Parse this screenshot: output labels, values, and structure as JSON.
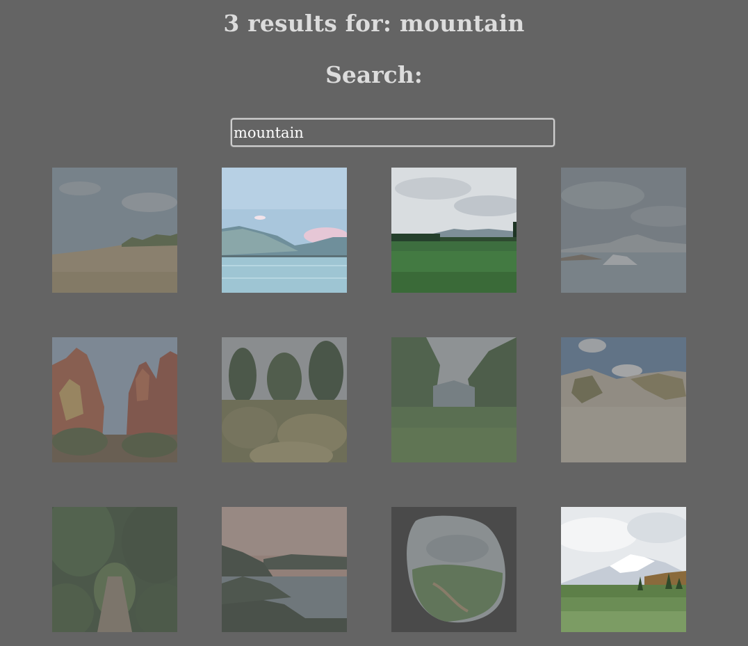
{
  "results": {
    "count": "3",
    "text": "3 results for: mountain"
  },
  "search": {
    "label": "Search:",
    "value": "mountain"
  },
  "gallery": {
    "images": [
      {
        "subject": "grassy-hill",
        "highlighted": false
      },
      {
        "subject": "mountain-lake",
        "highlighted": true
      },
      {
        "subject": "green-meadow-mountains",
        "highlighted": true
      },
      {
        "subject": "glacier-lagoon",
        "highlighted": false
      },
      {
        "subject": "red-rock-canyon",
        "highlighted": false
      },
      {
        "subject": "garden-shrubs",
        "highlighted": false
      },
      {
        "subject": "forest-valley",
        "highlighted": false
      },
      {
        "subject": "sand-dunes",
        "highlighted": false
      },
      {
        "subject": "forest-path",
        "highlighted": false
      },
      {
        "subject": "coastal-cliffs",
        "highlighted": false
      },
      {
        "subject": "cave-view",
        "highlighted": false
      },
      {
        "subject": "snowy-mountain-field",
        "highlighted": true
      }
    ]
  }
}
